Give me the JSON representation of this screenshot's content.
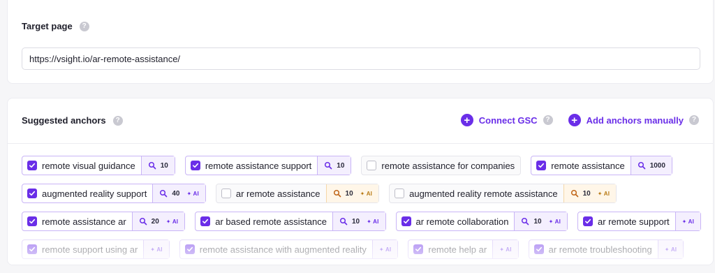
{
  "target_page": {
    "label": "Target page",
    "help_icon": "?",
    "url_value": "https://vsight.io/ar-remote-assistance/"
  },
  "anchors": {
    "label": "Suggested anchors",
    "help_icon": "?",
    "connect_gsc_label": "Connect GSC",
    "add_manually_label": "Add anchors manually",
    "accent_color": "#6a2ee8",
    "rows": [
      [
        {
          "text": "remote visual guidance",
          "checked": true,
          "count": "10",
          "ai": false,
          "tone": "purple"
        },
        {
          "text": "remote assistance support",
          "checked": true,
          "count": "10",
          "ai": false,
          "tone": "purple"
        },
        {
          "text": "remote assistance for companies",
          "checked": false,
          "count": "",
          "ai": false,
          "tone": "none"
        },
        {
          "text": "remote assistance",
          "checked": true,
          "count": "1000",
          "ai": false,
          "tone": "purple"
        }
      ],
      [
        {
          "text": "augmented reality support",
          "checked": true,
          "count": "40",
          "ai": true,
          "tone": "purple"
        },
        {
          "text": "ar remote assistance",
          "checked": false,
          "count": "10",
          "ai": true,
          "tone": "orange"
        },
        {
          "text": "augmented reality remote assistance",
          "checked": false,
          "count": "10",
          "ai": true,
          "tone": "orange"
        }
      ],
      [
        {
          "text": "remote assistance ar",
          "checked": true,
          "count": "20",
          "ai": true,
          "tone": "purple"
        },
        {
          "text": "ar based remote assistance",
          "checked": true,
          "count": "10",
          "ai": true,
          "tone": "purple"
        },
        {
          "text": "ar remote collaboration",
          "checked": true,
          "count": "10",
          "ai": true,
          "tone": "purple"
        },
        {
          "text": "ar remote support",
          "checked": true,
          "count": "",
          "ai": true,
          "tone": "purple"
        }
      ],
      [
        {
          "text": "remote support using ar",
          "checked": true,
          "count": "",
          "ai": true,
          "tone": "purple",
          "faded": true
        },
        {
          "text": "remote assistance with augmented reality",
          "checked": true,
          "count": "",
          "ai": true,
          "tone": "purple",
          "faded": true
        },
        {
          "text": "remote help ar",
          "checked": true,
          "count": "",
          "ai": true,
          "tone": "purple",
          "faded": true
        },
        {
          "text": "ar remote troubleshooting",
          "checked": true,
          "count": "",
          "ai": true,
          "tone": "purple",
          "faded": true
        }
      ]
    ],
    "ai_label": "AI"
  }
}
